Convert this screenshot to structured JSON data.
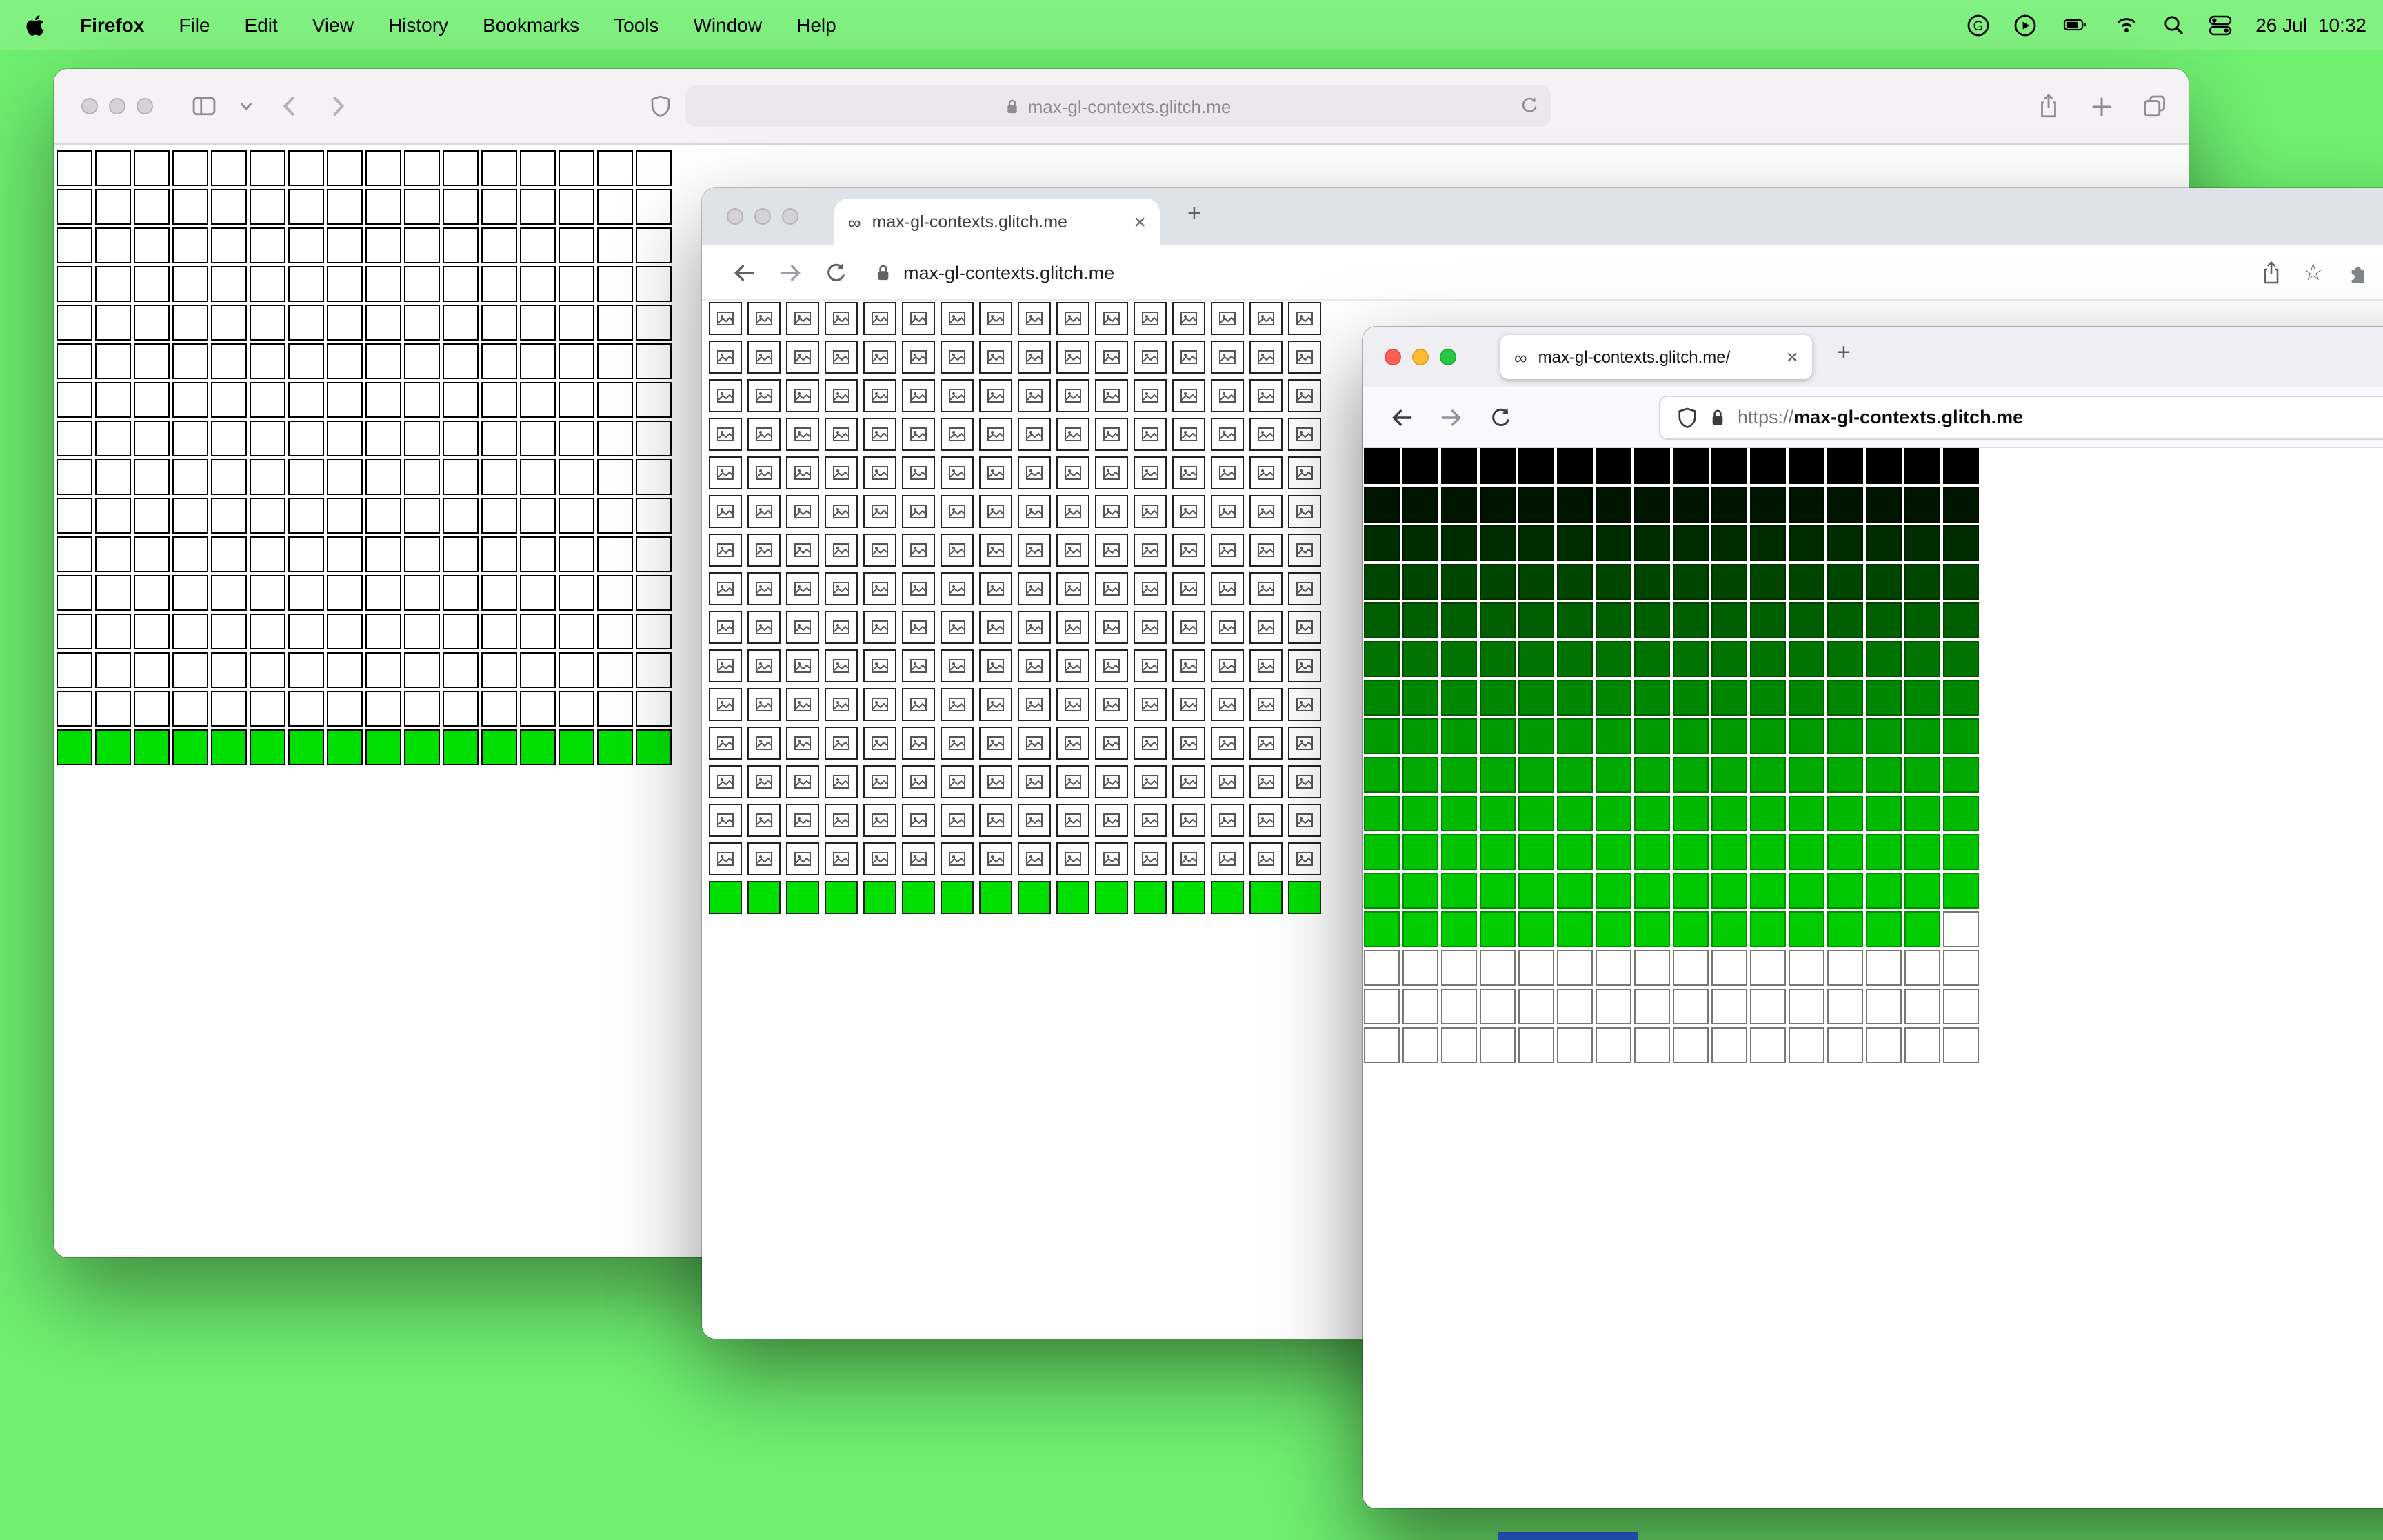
{
  "desktop": {
    "background": "#6ff06f",
    "menu_bar_background": "#81f281",
    "accent_strip_color": "#2e6bf0"
  },
  "menu_bar": {
    "app_name": "Firefox",
    "menus": [
      "File",
      "Edit",
      "View",
      "History",
      "Bookmarks",
      "Tools",
      "Window",
      "Help"
    ],
    "g_label": "G",
    "clock": {
      "date": "26 Jul",
      "time": "10:32"
    }
  },
  "icons": {
    "infinity": "∞",
    "close": "×",
    "plus": "+",
    "star": "☆"
  },
  "safari": {
    "url": "max-gl-contexts.glitch.me",
    "grid": {
      "cols": 16,
      "white_rows": 15,
      "green_rows": 1,
      "green": "#00e000",
      "cell": "#ffffff",
      "line": "#000000"
    }
  },
  "chrome": {
    "tab_title": "max-gl-contexts.glitch.me",
    "url": "max-gl-contexts.glitch.me",
    "grid": {
      "cols": 16,
      "icon_rows": 15,
      "green_rows": 1,
      "green": "#00e000"
    }
  },
  "firefox": {
    "tab_title": "max-gl-contexts.glitch.me/",
    "url_scheme": "https://",
    "url_host": "max-gl-contexts.glitch.me",
    "grid": {
      "cols": 16,
      "row_colors": [
        "#000000",
        "#001400",
        "#002d00",
        "#004600",
        "#005f00",
        "#007300",
        "#008700",
        "#009b00",
        "#00aa00",
        "#00b900",
        "#00c300",
        "#00c800",
        "#00cc00"
      ],
      "last_colored_row_trailing_white_cells": 1,
      "white_rows": 3
    }
  }
}
